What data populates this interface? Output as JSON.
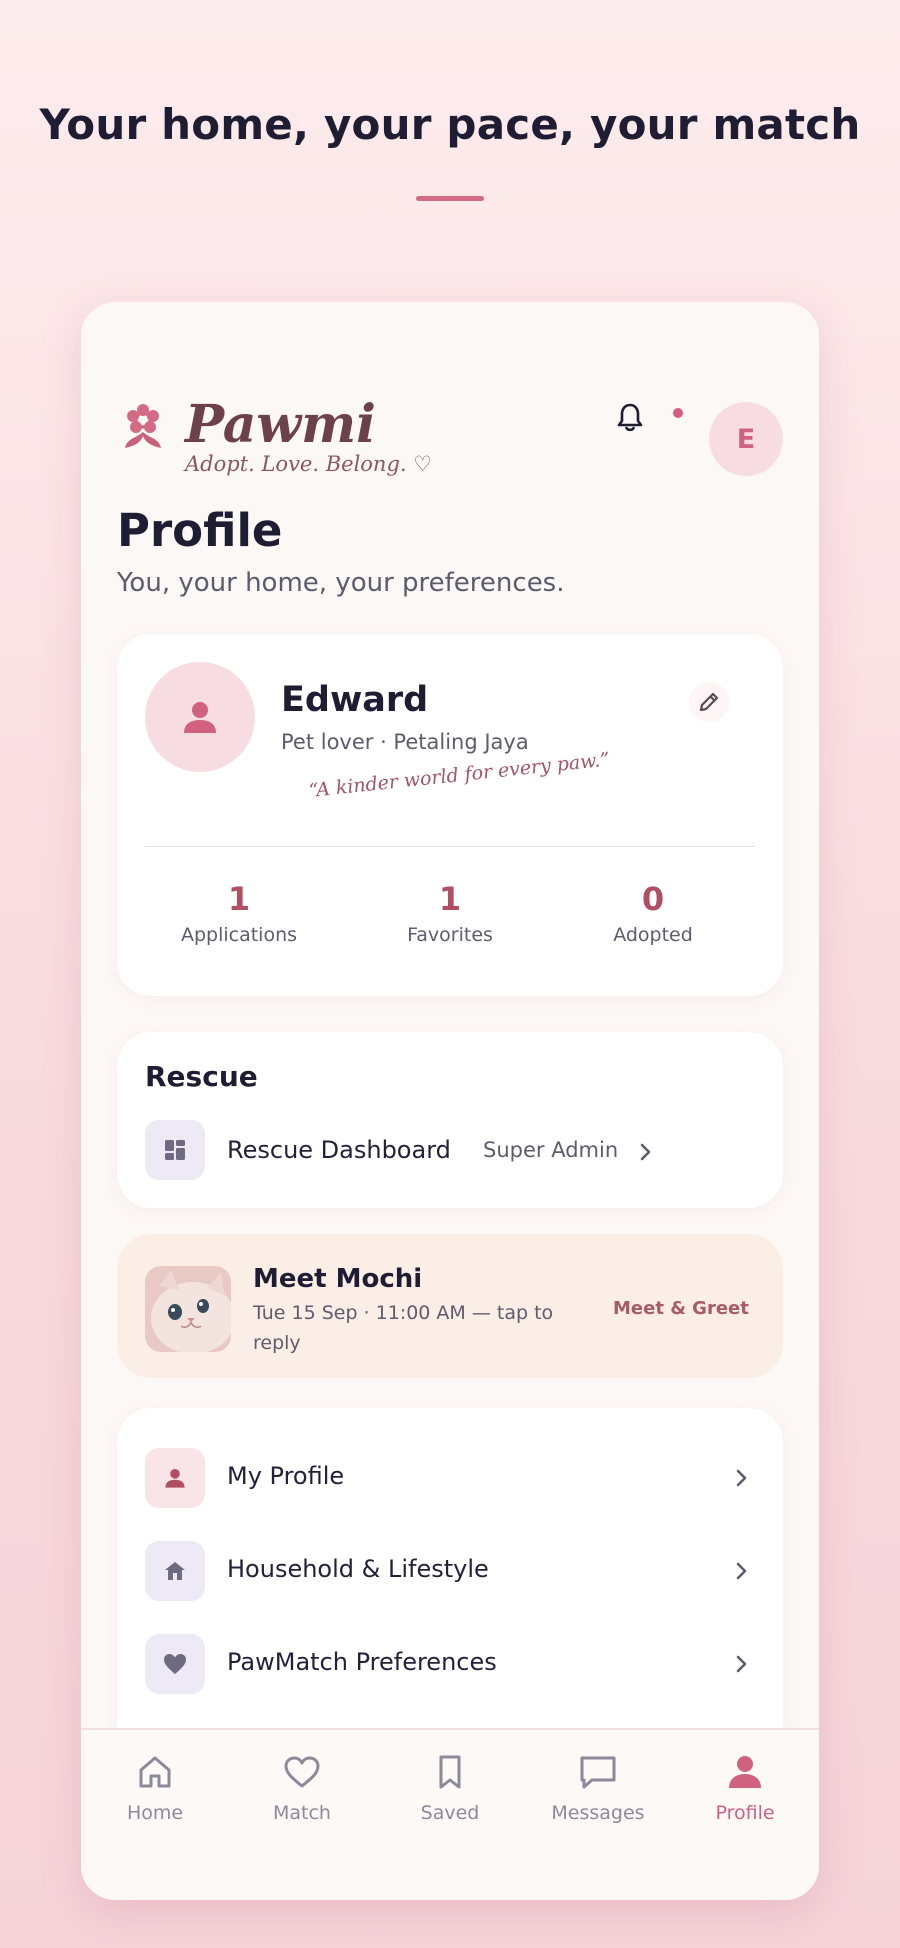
{
  "headline": "Your home, your pace, your match",
  "app": {
    "brand": "Pawmi",
    "tagline": "Adopt. Love. Belong. ♡",
    "avatar_initial": "E"
  },
  "page": {
    "title": "Profile",
    "subtitle": "You, your home, your preferences."
  },
  "profile": {
    "name": "Edward",
    "meta": "Pet lover · Petaling Jaya",
    "quote": "“A kinder world for every paw.”",
    "stats": [
      {
        "value": "1",
        "label": "Applications"
      },
      {
        "value": "1",
        "label": "Favorites"
      },
      {
        "value": "0",
        "label": "Adopted"
      }
    ]
  },
  "rescue": {
    "title": "Rescue",
    "row_label": "Rescue Dashboard",
    "row_badge": "Super Admin"
  },
  "meet": {
    "title": "Meet Mochi",
    "subtitle": "Tue 15 Sep · 11:00 AM — tap to reply",
    "tag": "Meet & Greet"
  },
  "menu": {
    "items": [
      {
        "label": "My Profile",
        "icon": "person-icon"
      },
      {
        "label": "Household & Lifestyle",
        "icon": "home-icon"
      },
      {
        "label": "PawMatch Preferences",
        "icon": "heart-icon"
      }
    ]
  },
  "nav": {
    "items": [
      {
        "label": "Home",
        "icon": "home-outline-icon"
      },
      {
        "label": "Match",
        "icon": "heart-outline-icon"
      },
      {
        "label": "Saved",
        "icon": "bookmark-icon"
      },
      {
        "label": "Messages",
        "icon": "chat-icon"
      },
      {
        "label": "Profile",
        "icon": "person-icon"
      }
    ],
    "active": "Profile"
  },
  "colors": {
    "accent": "#d1627f",
    "brand": "#6d4149",
    "stat": "#b04f62",
    "meet_bg": "#fbeee6"
  }
}
